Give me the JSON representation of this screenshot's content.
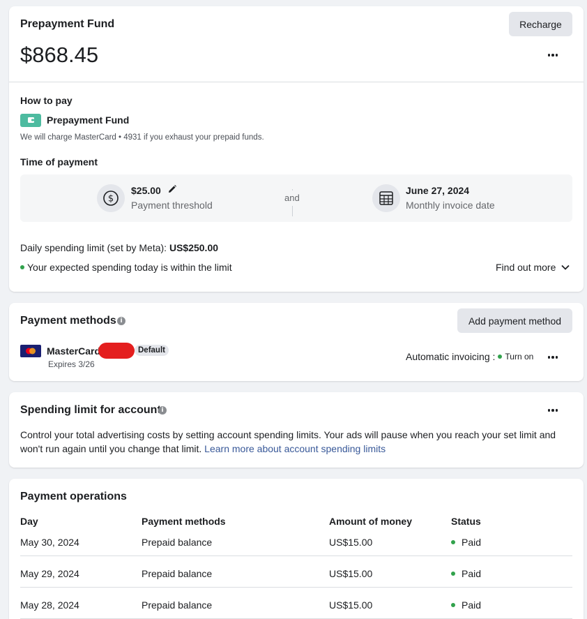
{
  "prepayment": {
    "title": "Prepayment Fund",
    "balance": "$868.45",
    "recharge_label": "Recharge",
    "how_to_pay_label": "How to pay",
    "method_name": "Prepayment Fund",
    "charge_note": "We will charge MasterCard • 4931 if you exhaust your prepaid funds.",
    "time_of_payment_label": "Time of payment",
    "threshold_value": "$25.00",
    "threshold_label": "Payment threshold",
    "and_label": "and",
    "invoice_date_value": "June 27, 2024",
    "invoice_date_label": "Monthly invoice date",
    "daily_limit_label": "Daily spending limit (set by Meta):",
    "daily_limit_value": "US$250.00",
    "expected_note": "Your expected spending today is within the limit",
    "find_out_more": "Find out more"
  },
  "payment_methods": {
    "title": "Payment methods",
    "add_label": "Add payment method",
    "card_name": "MasterCard",
    "default_badge": "Default",
    "expires": "Expires 3/26",
    "auto_invoicing_label": "Automatic invoicing :",
    "turn_on_label": "Turn on"
  },
  "spending_limit": {
    "title": "Spending limit for account",
    "description": "Control your total advertising costs by setting account spending limits. Your ads will pause when you reach your set limit and won't run again until you change that limit.",
    "learn_more": "Learn more about account spending limits"
  },
  "payment_operations": {
    "title": "Payment operations",
    "columns": [
      "Day",
      "Payment methods",
      "Amount of money",
      "Status"
    ],
    "rows": [
      {
        "day": "May 30, 2024",
        "method": "Prepaid balance",
        "amount": "US$15.00",
        "status": "Paid"
      },
      {
        "day": "May 29, 2024",
        "method": "Prepaid balance",
        "amount": "US$15.00",
        "status": "Paid"
      },
      {
        "day": "May 28, 2024",
        "method": "Prepaid balance",
        "amount": "US$15.00",
        "status": "Paid"
      }
    ]
  },
  "colors": {
    "accent_link": "#385898",
    "status_green": "#31a24c",
    "wallet_teal": "#4dbba0",
    "redaction_red": "#e41e1e"
  }
}
